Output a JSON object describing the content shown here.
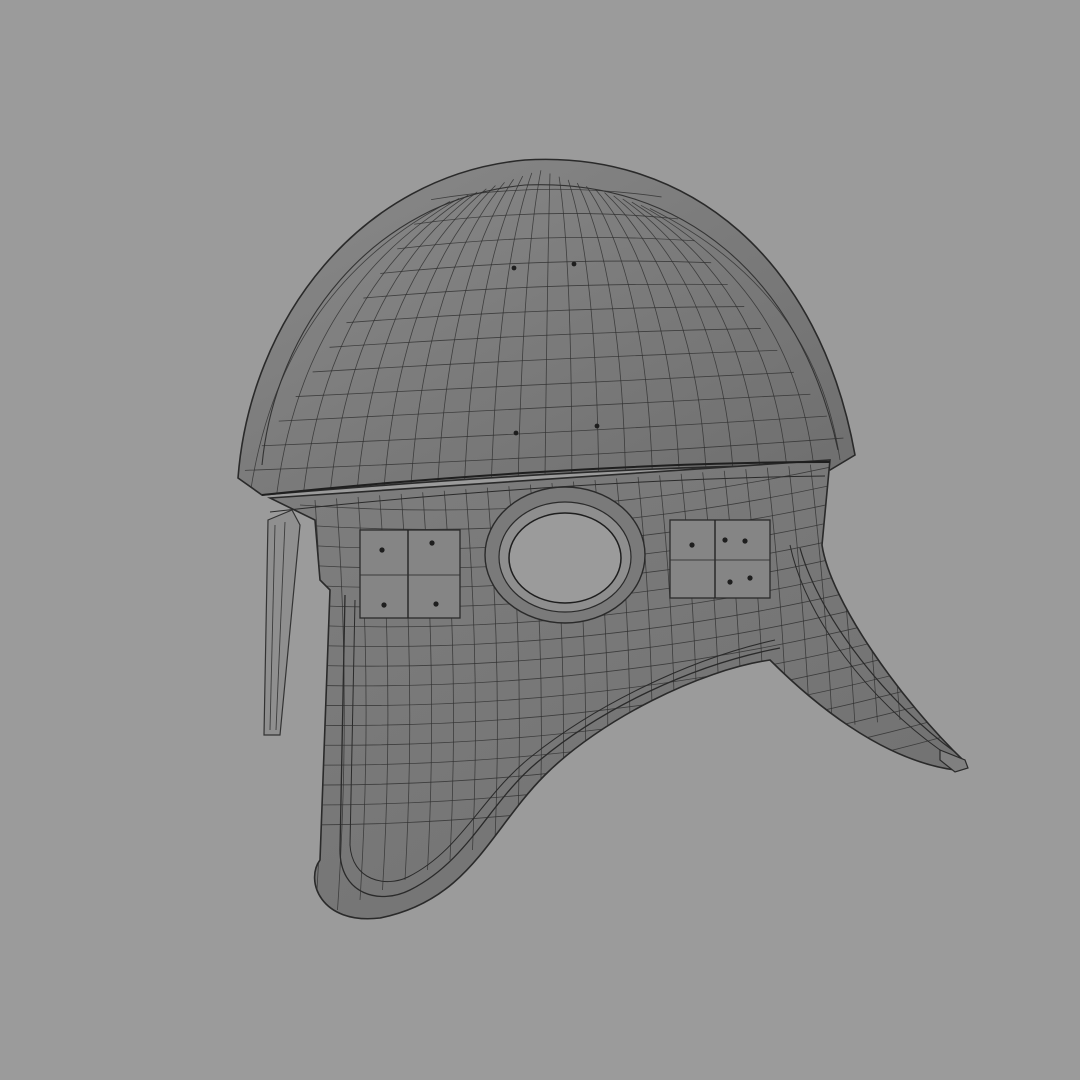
{
  "scene": {
    "background_color": "#9b9b9b",
    "subject": "helmet-wireframe-render",
    "shading": {
      "dome_base": "#7c7c7c",
      "dome_highlight": "#8e8e8e",
      "band": "#808080",
      "cheek": "#7a7a7a",
      "rim": "#8a8a8a",
      "eye_hole": "#9b9b9b",
      "wire": "#2e2e2e",
      "rivet": "#1e1e1e",
      "plate": "#858585"
    }
  }
}
